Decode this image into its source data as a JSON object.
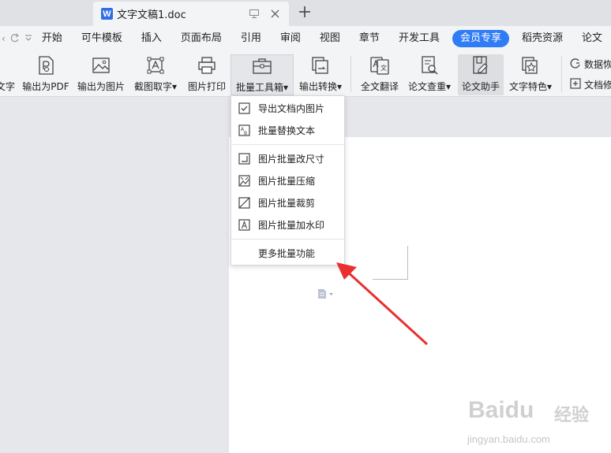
{
  "tab": {
    "title": "文字文稿1.doc",
    "doc_icon": "W"
  },
  "menu": {
    "items": [
      "开始",
      "可牛模板",
      "插入",
      "页面布局",
      "引用",
      "审阅",
      "视图",
      "章节",
      "开发工具",
      "会员专享",
      "稻壳资源",
      "论文"
    ],
    "active": "会员专享"
  },
  "ribbon": {
    "partial_left": "文字",
    "export_pdf": "输出为PDF",
    "export_image": "输出为图片",
    "screenshot_ocr": "截图取字",
    "image_print": "图片打印",
    "batch_toolbox": "批量工具箱",
    "output_convert": "输出转换",
    "full_translate": "全文翻译",
    "paper_check": "论文查重",
    "paper_assistant": "论文助手",
    "text_feature": "文字特色",
    "data_partial": "数据恢",
    "doc_repair_partial": "文档修"
  },
  "dropdown": {
    "items": [
      {
        "label": "导出文档内图片",
        "icon": "check-image-icon"
      },
      {
        "label": "批量替换文本",
        "icon": "replace-text-icon"
      },
      {
        "label": "图片批量改尺寸",
        "icon": "resize-icon"
      },
      {
        "label": "图片批量压缩",
        "icon": "compress-icon"
      },
      {
        "label": "图片批量裁剪",
        "icon": "crop-icon"
      },
      {
        "label": "图片批量加水印",
        "icon": "watermark-icon"
      }
    ],
    "more": "更多批量功能"
  },
  "watermark": {
    "brand": "Baidu",
    "cn": "经验",
    "url": "jingyan.baidu.com"
  },
  "colors": {
    "accent": "#2f7cf6",
    "arrow": "#e8302f",
    "doc_icon": "#2f6fe4"
  }
}
